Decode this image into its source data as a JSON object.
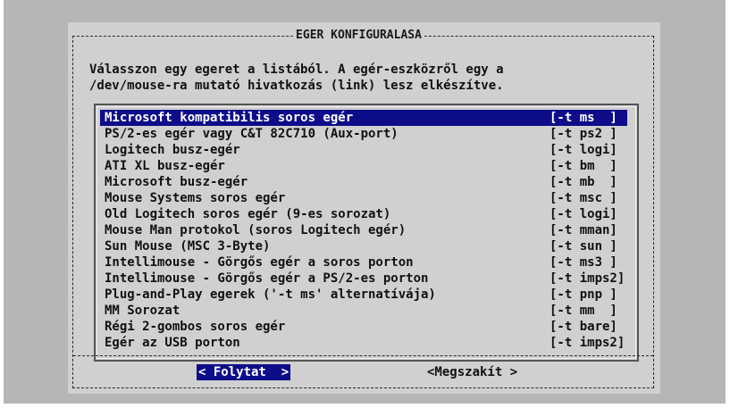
{
  "dialog": {
    "title": "EGER KONFIGURALASA",
    "description_lines": [
      "Válasszon egy egeret a listából. A egér-eszközről egy a",
      "/dev/mouse-ra mutató hivatkozás (link) lesz elkészítve."
    ]
  },
  "mouse_list": {
    "selected_index": 0,
    "items": [
      {
        "label": "Microsoft kompatibilis soros egér",
        "tag": "[-t ms  ]"
      },
      {
        "label": "PS/2-es egér vagy C&T 82C710 (Aux-port)",
        "tag": "[-t ps2 ]"
      },
      {
        "label": "Logitech busz-egér",
        "tag": "[-t logi]"
      },
      {
        "label": "ATI XL busz-egér",
        "tag": "[-t bm  ]"
      },
      {
        "label": "Microsoft busz-egér",
        "tag": "[-t mb  ]"
      },
      {
        "label": "Mouse Systems soros egér",
        "tag": "[-t msc ]"
      },
      {
        "label": "Old Logitech soros egér (9-es sorozat)",
        "tag": "[-t logi]"
      },
      {
        "label": "Mouse Man protokol (soros Logitech egér)",
        "tag": "[-t mman]"
      },
      {
        "label": "Sun Mouse (MSC 3-Byte)",
        "tag": "[-t sun ]"
      },
      {
        "label": "Intellimouse - Görgős egér a soros porton",
        "tag": "[-t ms3 ]"
      },
      {
        "label": "Intellimouse - Görgős egér a PS/2-es porton",
        "tag": "[-t imps2]"
      },
      {
        "label": "Plug-and-Play egerek ('-t ms' alternatívája)",
        "tag": "[-t pnp ]"
      },
      {
        "label": "MM Sorozat",
        "tag": "[-t mm  ]"
      },
      {
        "label": "Régi 2-gombos soros egér",
        "tag": "[-t bare]"
      },
      {
        "label": "Egér az USB porton",
        "tag": "[-t imps2]"
      }
    ]
  },
  "buttons": {
    "continue_label": "< Folytat  >",
    "cancel_label": "<Megszakít >"
  },
  "colors": {
    "selection_background": "#0d0d8a",
    "dialog_background": "#d0d0d0",
    "screen_background": "#b6b6b6"
  }
}
